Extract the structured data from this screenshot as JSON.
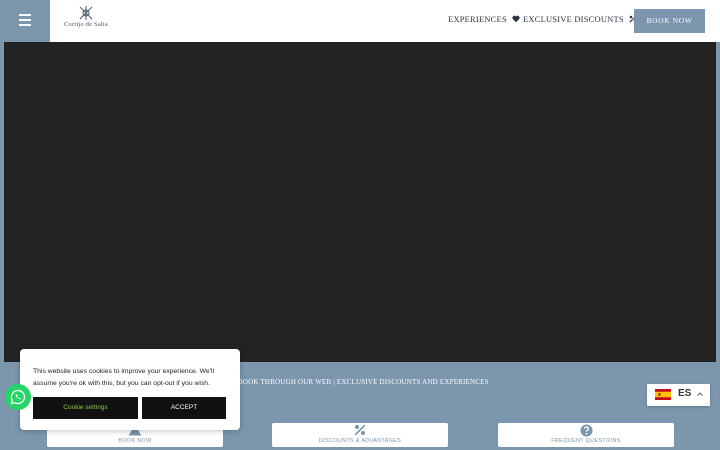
{
  "header": {
    "logo_text": "Cortijo de Salia",
    "nav": {
      "experiences": "EXPERIENCES",
      "exclusive_discounts": "EXCLUSIVE DISCOUNTS"
    },
    "book_now": "BOOK NOW"
  },
  "band": {
    "tagline": "BOOK THROUGH OUR WEB | EXCLUSIVE DISCOUNTS AND EXPERIENCES",
    "cards": [
      {
        "label": "BOOK NOW",
        "icon": "booking-bell-icon"
      },
      {
        "label": "DISCOUNTS & ADVANTAGES",
        "icon": "percent-icon"
      },
      {
        "label": "FREQUENT QUESTIONS",
        "icon": "question-circle-icon"
      }
    ]
  },
  "cookie": {
    "message": "This website uses cookies to improve your experience. We'll assume you're ok with this, but you can opt-out if you wish.",
    "settings_label": "Cookie settings",
    "accept_label": "ACCEPT"
  },
  "language": {
    "code": "ES"
  },
  "colors": {
    "accent": "#7b96ad",
    "video_bg": "#232323",
    "whatsapp": "#25d366",
    "cookie_settings_text": "#8bc34a"
  }
}
